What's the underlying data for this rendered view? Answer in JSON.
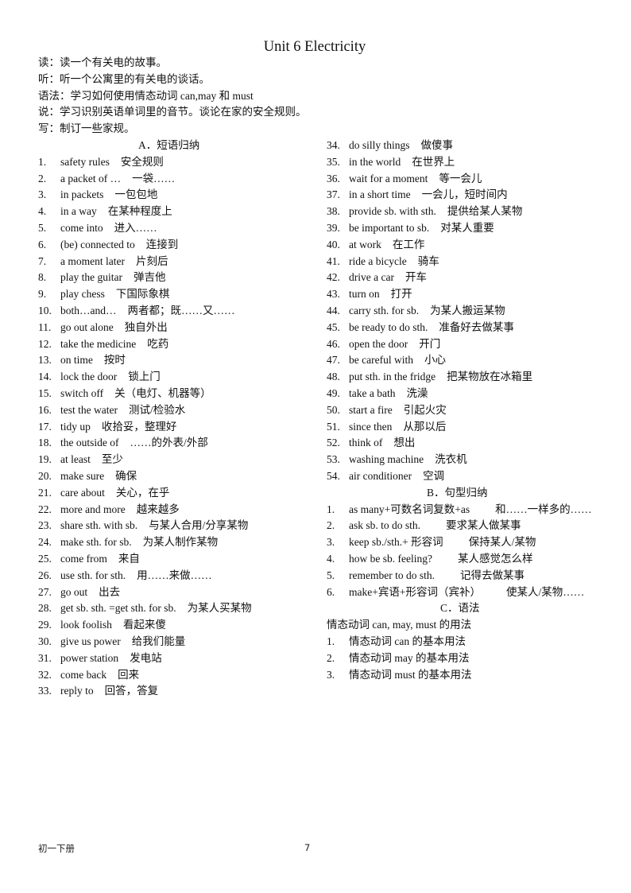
{
  "title": "Unit 6 Electricity",
  "intro": [
    "读：读一个有关电的故事。",
    "听：听一个公寓里的有关电的谈话。",
    "语法：学习如何使用情态动词 can,may 和 must",
    "说：学习识别英语单词里的音节。谈论在家的安全规则。",
    "写：制订一些家规。"
  ],
  "section_a": {
    "heading": "A．短语归纳",
    "items": [
      {
        "num": "1.",
        "en": "safety rules",
        "zh": "安全规则"
      },
      {
        "num": "2.",
        "en": "a packet of …",
        "zh": "一袋……"
      },
      {
        "num": "3.",
        "en": "in packets",
        "zh": "一包包地"
      },
      {
        "num": "4.",
        "en": "in a way",
        "zh": "在某种程度上"
      },
      {
        "num": "5.",
        "en": "come into",
        "zh": "进入……"
      },
      {
        "num": "6.",
        "en": "(be) connected to",
        "zh": "连接到"
      },
      {
        "num": "7.",
        "en": "a moment later",
        "zh": "片刻后"
      },
      {
        "num": "8.",
        "en": "play the guitar",
        "zh": "弹吉他"
      },
      {
        "num": "9.",
        "en": "play chess",
        "zh": "下国际象棋"
      },
      {
        "num": "10.",
        "en": "both…and…",
        "zh": "两者都；既……又……"
      },
      {
        "num": "11.",
        "en": "go out alone",
        "zh": "独自外出"
      },
      {
        "num": "12.",
        "en": "take the medicine",
        "zh": "吃药"
      },
      {
        "num": "13.",
        "en": "on time",
        "zh": "按时"
      },
      {
        "num": "14.",
        "en": "lock the door",
        "zh": "锁上门"
      },
      {
        "num": "15.",
        "en": "switch off",
        "zh": "关（电灯、机器等）"
      },
      {
        "num": "16.",
        "en": "test the water",
        "zh": "测试/检验水"
      },
      {
        "num": "17.",
        "en": "tidy up",
        "zh": "收拾妥，整理好"
      },
      {
        "num": "18.",
        "en": "the outside of",
        "zh": "……的外表/外部"
      },
      {
        "num": "19.",
        "en": "at least",
        "zh": "至少"
      },
      {
        "num": "20.",
        "en": "make sure",
        "zh": "确保"
      },
      {
        "num": "21.",
        "en": "care about",
        "zh": "关心，在乎"
      },
      {
        "num": "22.",
        "en": "more and more",
        "zh": "越来越多"
      },
      {
        "num": "23.",
        "en": "share sth. with sb.",
        "zh": "与某人合用/分享某物"
      },
      {
        "num": "24.",
        "en": "make sth. for sb.",
        "zh": "为某人制作某物"
      },
      {
        "num": "25.",
        "en": "come from",
        "zh": "来自"
      },
      {
        "num": "26.",
        "en": "use sth. for sth.",
        "zh": "用……来做……"
      },
      {
        "num": "27.",
        "en": "go out",
        "zh": "出去"
      },
      {
        "num": "28.",
        "en": "get sb. sth. =get sth. for sb.",
        "zh": "为某人买某物"
      },
      {
        "num": "29.",
        "en": "look foolish",
        "zh": "看起来傻"
      },
      {
        "num": "30.",
        "en": "give us power",
        "zh": "给我们能量"
      },
      {
        "num": "31.",
        "en": "power station",
        "zh": "发电站"
      },
      {
        "num": "32.",
        "en": "come back",
        "zh": "回来"
      },
      {
        "num": "33.",
        "en": "reply to",
        "zh": "回答，答复"
      },
      {
        "num": "34.",
        "en": "do silly things",
        "zh": "做傻事"
      },
      {
        "num": "35.",
        "en": "in the world",
        "zh": "在世界上"
      },
      {
        "num": "36.",
        "en": "wait for a moment",
        "zh": "等一会儿"
      },
      {
        "num": "37.",
        "en": "in a short time",
        "zh": "一会儿，短时间内"
      },
      {
        "num": "38.",
        "en": "provide sb. with sth.",
        "zh": "提供给某人某物"
      },
      {
        "num": "39.",
        "en": "be important to sb.",
        "zh": "对某人重要"
      },
      {
        "num": "40.",
        "en": "at work",
        "zh": "在工作"
      },
      {
        "num": "41.",
        "en": "ride a bicycle",
        "zh": "骑车"
      },
      {
        "num": "42.",
        "en": "drive a car",
        "zh": "开车"
      },
      {
        "num": "43.",
        "en": "turn on",
        "zh": "打开"
      },
      {
        "num": "44.",
        "en": "carry sth. for sb.",
        "zh": "为某人搬运某物"
      },
      {
        "num": "45.",
        "en": "be ready to do sth.",
        "zh": "准备好去做某事"
      },
      {
        "num": "46.",
        "en": "open the door",
        "zh": "开门"
      },
      {
        "num": "47.",
        "en": "be careful with",
        "zh": "小心"
      },
      {
        "num": "48.",
        "en": "put sth. in the fridge",
        "zh": "把某物放在冰箱里"
      },
      {
        "num": "49.",
        "en": "take a bath",
        "zh": "洗澡"
      },
      {
        "num": "50.",
        "en": "start a fire",
        "zh": "引起火灾"
      },
      {
        "num": "51.",
        "en": "since then",
        "zh": "从那以后"
      },
      {
        "num": "52.",
        "en": "think of",
        "zh": "想出"
      },
      {
        "num": "53.",
        "en": "washing machine",
        "zh": "洗衣机"
      },
      {
        "num": "54.",
        "en": "air conditioner",
        "zh": "空调"
      }
    ]
  },
  "section_b": {
    "heading": "B．句型归纳",
    "items": [
      {
        "num": "1.",
        "en": "as many+可数名词复数+as",
        "zh": "和……一样多的……"
      },
      {
        "num": "2.",
        "en": "ask sb. to do sth.",
        "zh": "要求某人做某事"
      },
      {
        "num": "3.",
        "en": "keep sb./sth.+ 形容词",
        "zh": "保持某人/某物"
      },
      {
        "num": "4.",
        "en": "how be sb. feeling?",
        "zh": "某人感觉怎么样"
      },
      {
        "num": "5.",
        "en": "remember to do sth.",
        "zh": "记得去做某事"
      },
      {
        "num": "6.",
        "en": "make+宾语+形容词（宾补）",
        "zh": "使某人/某物……"
      }
    ]
  },
  "section_c": {
    "heading": "C．语法",
    "intro": "情态动词 can, may, must 的用法",
    "items": [
      {
        "num": "1.",
        "text": "情态动词 can 的基本用法"
      },
      {
        "num": "2.",
        "text": "情态动词 may 的基本用法"
      },
      {
        "num": "3.",
        "text": "情态动词 must 的基本用法"
      }
    ]
  },
  "footer": {
    "left": "初一下册",
    "page": "7"
  }
}
